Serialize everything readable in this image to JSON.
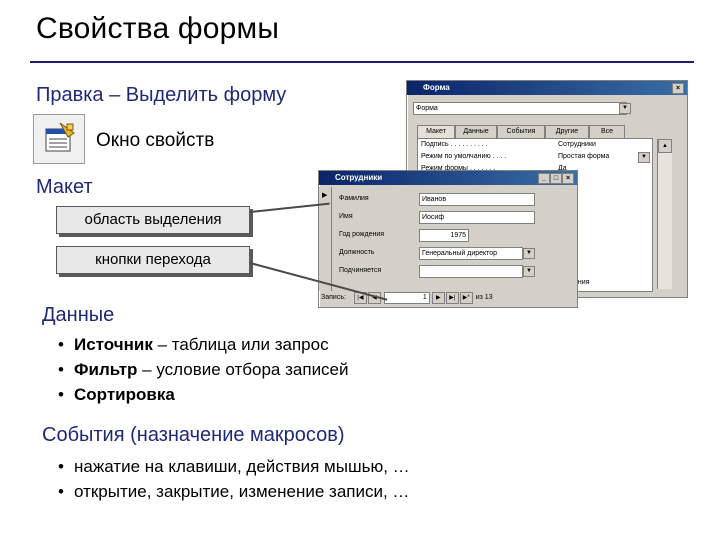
{
  "slide": {
    "title": "Свойства формы",
    "menu_path": "Правка – Выделить форму",
    "properties_window_label": "Окно свойств",
    "layout_heading": "Макет",
    "callouts": [
      "область выделения",
      "кнопки перехода"
    ],
    "data_heading": "Данные",
    "data_items": [
      {
        "bold": "Источник",
        "rest": " – таблица или запрос"
      },
      {
        "bold": "Фильтр",
        "rest": " – условие отбора записей"
      },
      {
        "bold": "Сортировка",
        "rest": ""
      }
    ],
    "events_heading": "События (назначение макросов)",
    "events_items": [
      "нажатие на клавиши, действия мышью, …",
      "открытие, закрытие, изменение записи, …"
    ]
  },
  "property_sheet": {
    "title": "Форма",
    "selector_value": "Форма",
    "tabs": [
      "Макет",
      "Данные",
      "События",
      "Другие",
      "Все"
    ],
    "rows": [
      {
        "label": "Подпись . . . . . . . . . .",
        "value": "Сотрудники"
      },
      {
        "label": "Режим по умолчанию . . . .",
        "value": "Простая форма"
      },
      {
        "label": "Режим формы . . . . . . .",
        "value": "Да"
      }
    ],
    "partial_values": [
      "в",
      "ения"
    ]
  },
  "employee_form": {
    "title": "Сотрудники",
    "fields": [
      {
        "label": "Фамилия",
        "value": "Иванов"
      },
      {
        "label": "Имя",
        "value": "Иосиф"
      },
      {
        "label": "Год рождения",
        "value": "1975"
      },
      {
        "label": "Должность",
        "value": "Генеральный директор"
      },
      {
        "label": "Подчиняется",
        "value": ""
      }
    ],
    "nav": {
      "label": "Запись:",
      "current": "1",
      "total_text": "из 13"
    }
  },
  "colors": {
    "heading_blue": "#1e2a78",
    "title_bar": "#0a246a",
    "window_gray": "#d4d0c8"
  }
}
